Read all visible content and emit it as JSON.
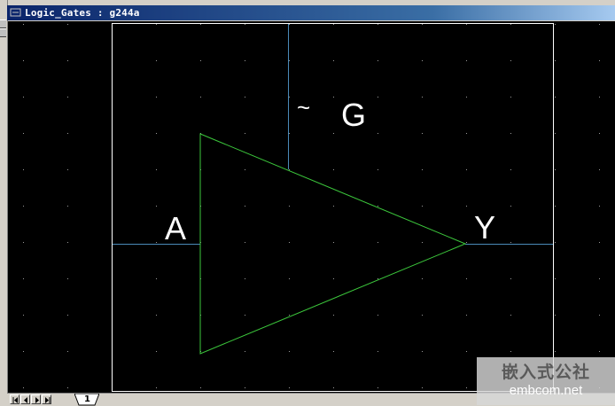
{
  "window": {
    "title": "Logic_Gates : g244a"
  },
  "schematic": {
    "gate_type": "buffer-tristate",
    "colors": {
      "background": "#000000",
      "grid_dots": "#9a9a9a",
      "border": "#ffffff",
      "pins": "#4a8ab8",
      "gate_body": "#3cc83c",
      "labels": "#ffffff"
    },
    "pin_labels": {
      "input": "A",
      "output": "Y",
      "enable_prefix": "~",
      "enable": "G"
    }
  },
  "sheet_tabs": [
    {
      "label": "1",
      "active": true
    }
  ],
  "watermark": {
    "line1": "嵌入式公社",
    "line2": "embcom.net"
  }
}
